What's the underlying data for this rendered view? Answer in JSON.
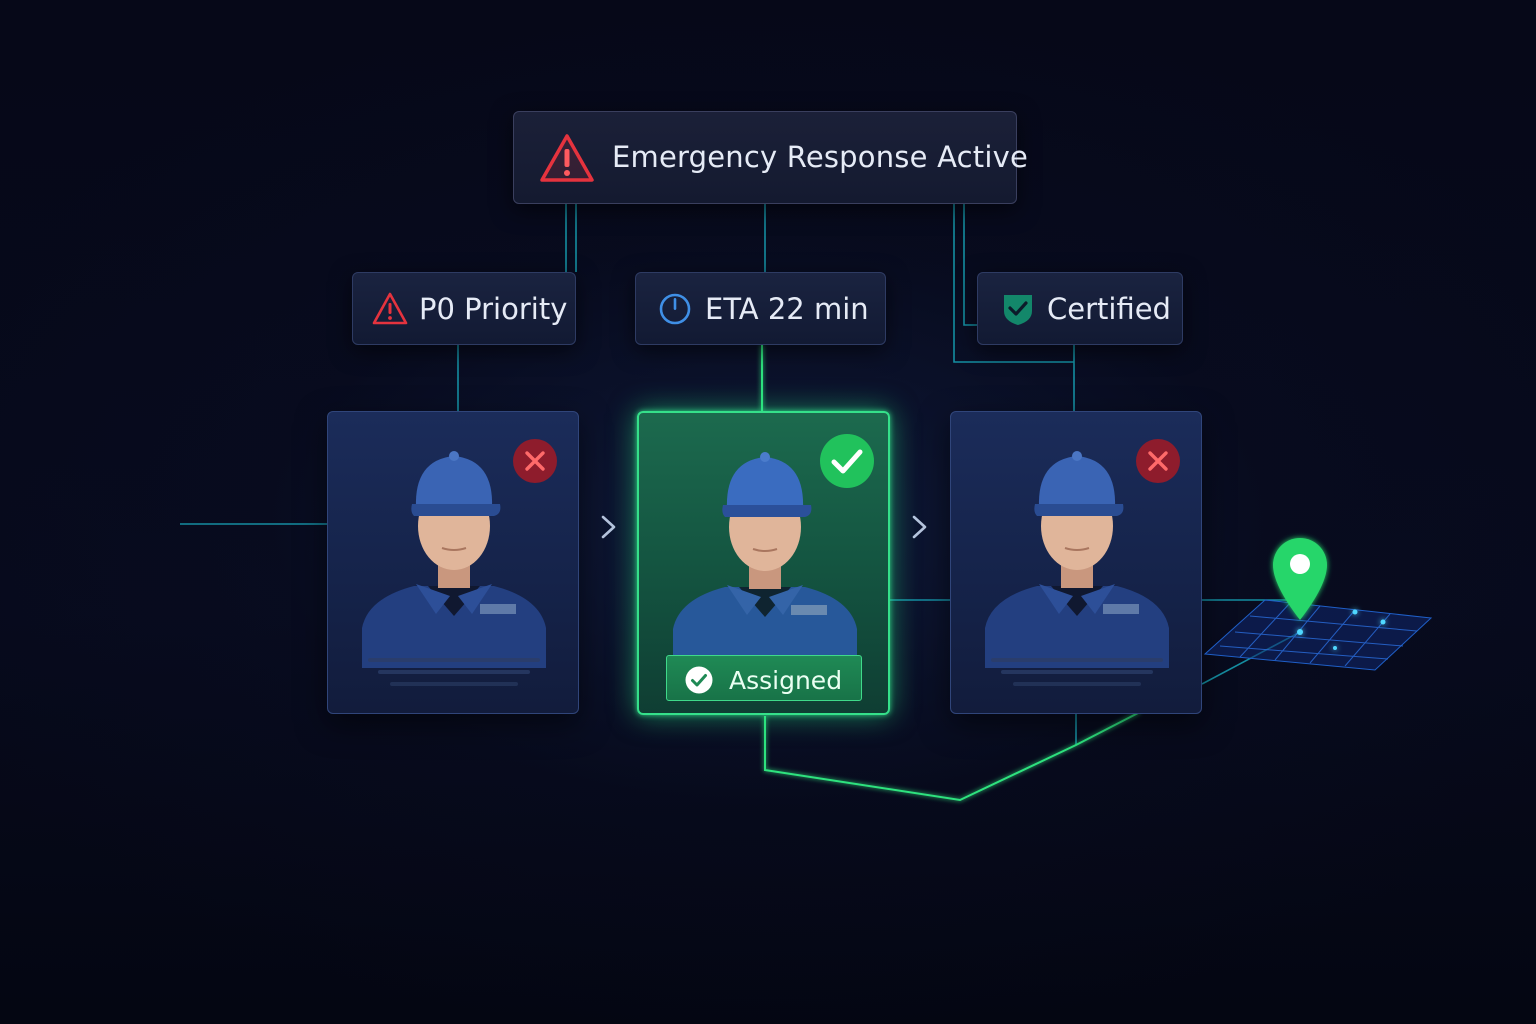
{
  "banner": {
    "label": "Emergency Response Active",
    "icon": "warning-triangle-icon",
    "color": "#e5333e"
  },
  "tags": {
    "priority": {
      "label": "P0 Priority",
      "icon": "warning-triangle-icon",
      "color": "#e5333e"
    },
    "eta": {
      "label": "ETA 22 min",
      "icon": "clock-icon",
      "color": "#3f8fe6"
    },
    "certified": {
      "label": "Certified",
      "icon": "shield-check-icon",
      "color": "#1fae7a"
    }
  },
  "cards": [
    {
      "status": "rejected",
      "badge_icon": "x-circle-icon"
    },
    {
      "status": "assigned",
      "badge_icon": "check-circle-icon",
      "assigned_label": "Assigned"
    },
    {
      "status": "rejected",
      "badge_icon": "x-circle-icon"
    }
  ],
  "colors": {
    "accent_green": "#30e080",
    "reject_red": "#c0283a",
    "wire_cyan": "#1ec8d8"
  },
  "map": {
    "icon": "location-pin-icon"
  }
}
